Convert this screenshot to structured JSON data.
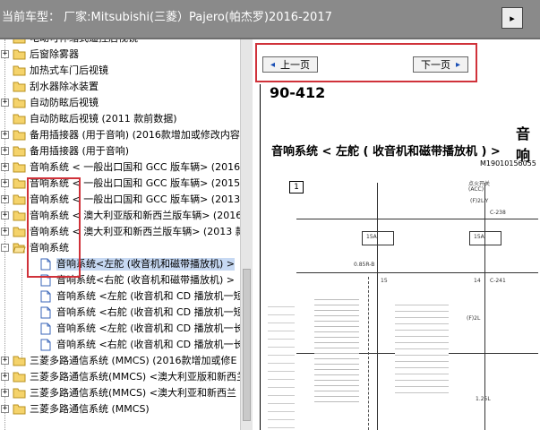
{
  "window": {
    "title": "当前车型： 厂家:Mitsubishi(三菱）Pajero(帕杰罗)2016-2017",
    "corner_button": "▸"
  },
  "tree": {
    "items": [
      {
        "label": "电动可伸缩式遥控后视镜",
        "expander": "",
        "type": "folder"
      },
      {
        "label": "后窗除雾器",
        "expander": "+",
        "type": "folder"
      },
      {
        "label": "加热式车门后视镜",
        "expander": "",
        "type": "folder"
      },
      {
        "label": "刮水器除冰装置",
        "expander": "",
        "type": "folder"
      },
      {
        "label": "自动防眩后视镜",
        "expander": "+",
        "type": "folder"
      },
      {
        "label": "自动防眩后视镜 (2011 款前数据)",
        "expander": "",
        "type": "folder"
      },
      {
        "label": "备用插接器 (用于音响) (2016款增加或修改内容",
        "expander": "+",
        "type": "folder"
      },
      {
        "label": "备用插接器 (用于音响)",
        "expander": "+",
        "type": "folder"
      },
      {
        "label": "音响系统 < 一般出口国和 GCC 版车辆> (2016",
        "expander": "+",
        "type": "folder"
      },
      {
        "label": "音响系统 < 一般出口国和 GCC 版车辆> (2015",
        "expander": "+",
        "type": "folder"
      },
      {
        "label": "音响系统 < 一般出口国和 GCC 版车辆> (2013",
        "expander": "+",
        "type": "folder"
      },
      {
        "label": "音响系统 < 澳大利亚版和新西兰版车辆> (2016",
        "expander": "+",
        "type": "folder"
      },
      {
        "label": "音响系统 < 澳大利亚和新西兰版车辆> (2013 款",
        "expander": "+",
        "type": "folder"
      },
      {
        "label": "音响系统",
        "expander": "-",
        "type": "folder-open"
      },
      {
        "label": "音响系统<左舵 (收音机和磁带播放机) >",
        "expander": "",
        "type": "page",
        "selected": true
      },
      {
        "label": "音响系统<右舵 (收音机和磁带播放机) >",
        "expander": "",
        "type": "page"
      },
      {
        "label": "音响系统 <左舵 (收音机和 CD 播放机一短",
        "expander": "",
        "type": "page"
      },
      {
        "label": "音响系统 <右舵 (收音机和 CD 播放机一短",
        "expander": "",
        "type": "page"
      },
      {
        "label": "音响系统 <左舵 (收音机和 CD 播放机一长",
        "expander": "",
        "type": "page"
      },
      {
        "label": "音响系统 <右舵 (收音机和 CD 播放机一长",
        "expander": "",
        "type": "page"
      },
      {
        "label": "三菱多路通信系统 (MMCS) (2016款增加或修E",
        "expander": "+",
        "type": "folder"
      },
      {
        "label": "三菱多路通信系统(MMCS) <澳大利亚版和新西兰",
        "expander": "+",
        "type": "folder"
      },
      {
        "label": "三菱多路通信系统(MMCS) <澳大利亚和新西兰",
        "expander": "+",
        "type": "folder"
      },
      {
        "label": "三菱多路通信系统 (MMCS)",
        "expander": "+",
        "type": "folder"
      }
    ]
  },
  "nav": {
    "prev_label": "上一页",
    "next_label": "下一页",
    "prev_arrow": "◂",
    "next_arrow": "▸"
  },
  "document": {
    "page_number": "90-412",
    "section_heading": "音响",
    "circuit_title": "音响系统 < 左舵 ( 收音机和磁带播放机 ) >",
    "diagram_code": "M19010156055",
    "box_label": "1",
    "labels": [
      "点火开关",
      "(ACC)",
      "(F)2L-Y",
      "C-238",
      "15A",
      "15A",
      "0.85R-B",
      "15",
      "14",
      "C-241",
      "(F)2L",
      "1.25L"
    ]
  },
  "colors": {
    "titlebar": "#8a8a8a",
    "highlight": "#d0323a",
    "selection": "#c7d9f3"
  }
}
